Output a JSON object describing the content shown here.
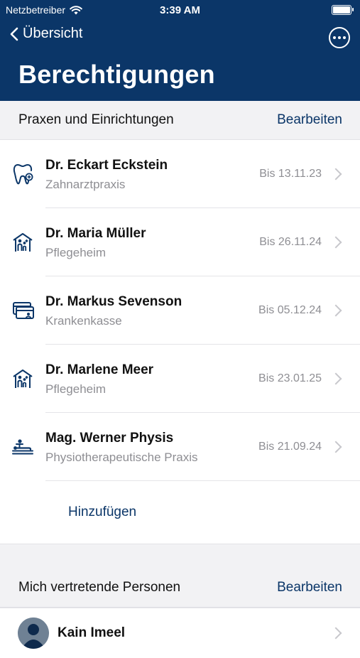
{
  "status": {
    "carrier": "Netzbetreiber",
    "time": "3:39 AM"
  },
  "nav": {
    "back_label": "Übersicht",
    "title": "Berechtigungen"
  },
  "practices": {
    "header": "Praxen und Einrichtungen",
    "edit_label": "Bearbeiten",
    "items": [
      {
        "name": "Dr. Eckart Eckstein",
        "type": "Zahnarztpraxis",
        "until": "Bis 13.11.23",
        "icon": "tooth-icon"
      },
      {
        "name": "Dr. Maria Müller",
        "type": "Pflegeheim",
        "until": "Bis 26.11.24",
        "icon": "care-home-icon"
      },
      {
        "name": "Dr. Markus Sevenson",
        "type": "Krankenkasse",
        "until": "Bis 05.12.24",
        "icon": "insurance-card-icon"
      },
      {
        "name": "Dr. Marlene Meer",
        "type": "Pflegeheim",
        "until": "Bis 23.01.25",
        "icon": "care-home-icon"
      },
      {
        "name": "Mag. Werner Physis",
        "type": "Physiotherapeutische Praxis",
        "until": "Bis 21.09.24",
        "icon": "physiotherapy-icon"
      }
    ],
    "add_label": "Hinzufügen"
  },
  "representatives": {
    "header": "Mich vertretende Personen",
    "edit_label": "Bearbeiten",
    "items": [
      {
        "name": "Kain Imeel"
      }
    ]
  },
  "colors": {
    "brand": "#0b3668",
    "secondary_text": "#8e8e93",
    "section_bg": "#f2f2f4"
  }
}
